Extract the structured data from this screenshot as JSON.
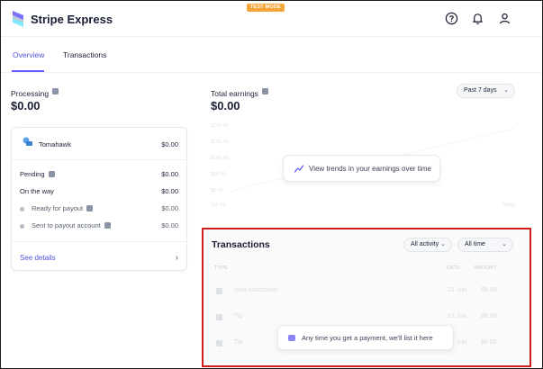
{
  "header": {
    "app_title": "Stripe Express",
    "badge": "TEST MODE",
    "icons": [
      "help-icon",
      "bell-icon",
      "user-icon"
    ],
    "brand_color": "#635bff"
  },
  "tabs": [
    {
      "label": "Overview",
      "active": true
    },
    {
      "label": "Transactions",
      "active": false
    }
  ],
  "processing": {
    "label": "Processing",
    "amount": "$0.00",
    "account": {
      "name": "Tomahawk",
      "amount": "$0.00"
    },
    "rows": [
      {
        "label": "Pending",
        "value": "$0.00"
      },
      {
        "label": "On the way",
        "value": "$0.00"
      },
      {
        "label": "Ready for payout",
        "value": "$0.00"
      },
      {
        "label": "Sent to payout account",
        "value": "$0.00"
      }
    ],
    "see_details": "See details"
  },
  "earnings": {
    "label": "Total earnings",
    "amount": "$0.00",
    "period": "Past 7 days",
    "y_ticks": [
      "$200.00",
      "$150.00",
      "$100.00",
      "$50.00",
      "$0.00"
    ],
    "x_ticks": [
      "Jun 15",
      "Today"
    ],
    "trend_message": "View trends in your earnings over time"
  },
  "transactions": {
    "title": "Transactions",
    "filter_activity": "All activity",
    "filter_time": "All time",
    "columns": [
      "TYPE",
      "DATE",
      "AMOUNT"
    ],
    "rows": [
      {
        "type": "New subscriber",
        "date": "21 Jun",
        "amount": "$8.00"
      },
      {
        "type": "Tip",
        "date": "21 Jun",
        "amount": "$8.00"
      },
      {
        "type": "Tip",
        "date": "21 Jun",
        "amount": "$8.00"
      }
    ],
    "empty_message": "Any time you get a payment, we'll list it here"
  }
}
